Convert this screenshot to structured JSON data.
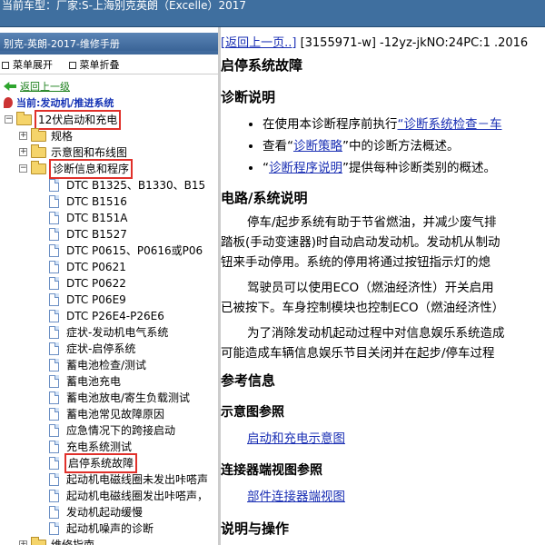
{
  "top_bar": {
    "text": "当前车型：厂家:S-上海别克英朗（Excelle）2017"
  },
  "left_panel": {
    "title": "别克-英朗-2017-维修手册",
    "toolbar": {
      "expand_all": "菜单展开",
      "collapse_all": "菜单折叠"
    },
    "back_link": "返回上一级",
    "current": "当前:发动机/推进系统",
    "tree": [
      {
        "label": "12伏启动和充电",
        "level": 0,
        "kind": "folder",
        "exp": "−",
        "boxed": true
      },
      {
        "label": "规格",
        "level": 1,
        "kind": "folder",
        "exp": "+"
      },
      {
        "label": "示意图和布线图",
        "level": 1,
        "kind": "folder",
        "exp": "+"
      },
      {
        "label": "诊断信息和程序",
        "level": 1,
        "kind": "folder",
        "exp": "−",
        "boxed": true
      },
      {
        "label": "DTC B1325、B1330、B15",
        "level": 2,
        "kind": "doc"
      },
      {
        "label": "DTC B1516",
        "level": 2,
        "kind": "doc"
      },
      {
        "label": "DTC B151A",
        "level": 2,
        "kind": "doc"
      },
      {
        "label": "DTC B1527",
        "level": 2,
        "kind": "doc"
      },
      {
        "label": "DTC P0615、P0616或P06",
        "level": 2,
        "kind": "doc"
      },
      {
        "label": "DTC P0621",
        "level": 2,
        "kind": "doc"
      },
      {
        "label": "DTC P0622",
        "level": 2,
        "kind": "doc"
      },
      {
        "label": "DTC P06E9",
        "level": 2,
        "kind": "doc"
      },
      {
        "label": "DTC P26E4-P26E6",
        "level": 2,
        "kind": "doc"
      },
      {
        "label": "症状-发动机电气系统",
        "level": 2,
        "kind": "doc"
      },
      {
        "label": "症状-启停系统",
        "level": 2,
        "kind": "doc"
      },
      {
        "label": "蓄电池检查/测试",
        "level": 2,
        "kind": "doc"
      },
      {
        "label": "蓄电池充电",
        "level": 2,
        "kind": "doc"
      },
      {
        "label": "蓄电池放电/寄生负载测试",
        "level": 2,
        "kind": "doc"
      },
      {
        "label": "蓄电池常见故障原因",
        "level": 2,
        "kind": "doc"
      },
      {
        "label": "应急情况下的跨接启动",
        "level": 2,
        "kind": "doc"
      },
      {
        "label": "充电系统测试",
        "level": 2,
        "kind": "doc"
      },
      {
        "label": "启停系统故障",
        "level": 2,
        "kind": "doc",
        "boxed": true
      },
      {
        "label": "起动机电磁线圈未发出咔嗒声",
        "level": 2,
        "kind": "doc"
      },
      {
        "label": "起动机电磁线圈发出咔嗒声，",
        "level": 2,
        "kind": "doc"
      },
      {
        "label": "发动机起动缓慢",
        "level": 2,
        "kind": "doc"
      },
      {
        "label": "起动机噪声的诊断",
        "level": 2,
        "kind": "doc"
      },
      {
        "label": "维修指南",
        "level": 1,
        "kind": "folder",
        "exp": "+"
      }
    ]
  },
  "doc": {
    "back_link": "[返回上一页..]",
    "doc_ref": "[3155971-w] -12yz-jkNO:24PC:1 .2016",
    "title": "启停系统故障",
    "diag_heading": "诊断说明",
    "bullets": [
      {
        "pre": "在使用本诊断程序前执行",
        "link": "“诊断系统检查－车",
        "post": ""
      },
      {
        "pre": "查看“",
        "link": "诊断策略",
        "post": "”中的诊断方法概述。"
      },
      {
        "pre": "“",
        "link": "诊断程序说明",
        "post": "”提供每种诊断类别的概述。"
      }
    ],
    "circuit_heading": "电路/系统说明",
    "circuit_para1": [
      "停车/起步系统有助于节省燃油，并减少废气排",
      "踏板(手动变速器)时自动启动发动机。发动机从制动",
      "钮来手动停用。系统的停用将通过按钮指示灯的熄"
    ],
    "circuit_para2": [
      "驾驶员可以使用ECO（燃油经济性）开关启用",
      "已被按下。车身控制模块也控制ECO（燃油经济性）"
    ],
    "circuit_para3": [
      "为了消除发动机起动过程中对信息娱乐系统造成",
      "可能造成车辆信息娱乐节目关闭并在起步/停车过程"
    ],
    "ref_heading": "参考信息",
    "schematic_ref_heading": "示意图参照",
    "schematic_link": "启动和充电示意图",
    "connector_ref_heading": "连接器端视图参照",
    "connector_link": "部件连接器端视图",
    "ops_heading": "说明与操作"
  }
}
